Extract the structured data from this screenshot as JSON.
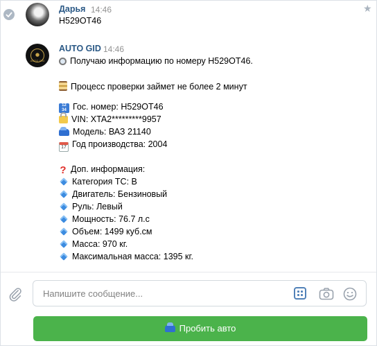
{
  "messages": [
    {
      "sender": "Дарья",
      "time": "14:46",
      "text": "Н529ОТ46"
    },
    {
      "sender": "AUTO GID",
      "time": "14:46",
      "avatar_text": "AUTO GID",
      "lines": [
        {
          "icon": "magnifier-icon",
          "text": "Получаю информацию по номеру Н529ОТ46."
        },
        {
          "icon": "hourglass-icon",
          "text": "Процесс проверки займет не более 2 минут"
        },
        {
          "icon": "numbers-1234-icon",
          "text": "Гос. номер: Н529ОТ46"
        },
        {
          "icon": "lock-icon",
          "text": "VIN: XTA2*********9957"
        },
        {
          "icon": "car-icon",
          "text": "Модель: ВАЗ 21140"
        },
        {
          "icon": "calendar-icon",
          "text": "Год производства: 2004"
        },
        {
          "icon": "question-icon",
          "text": "Доп. информация:"
        },
        {
          "icon": "diamond-icon",
          "text": "Категория ТС: B"
        },
        {
          "icon": "diamond-icon",
          "text": "Двигатель: Бензиновый"
        },
        {
          "icon": "diamond-icon",
          "text": "Руль: Левый"
        },
        {
          "icon": "diamond-icon",
          "text": "Мощность: 76.7 л.с"
        },
        {
          "icon": "diamond-icon",
          "text": "Объем: 1499 куб.см"
        },
        {
          "icon": "diamond-icon",
          "text": "Масса: 970 кг."
        },
        {
          "icon": "diamond-icon",
          "text": "Максимальная масса: 1395 кг."
        }
      ]
    }
  ],
  "composer": {
    "placeholder": "Напишите сообщение..."
  },
  "keyboard_button": {
    "label": "Пробить авто",
    "icon": "car-icon",
    "color": "#4bb34b"
  },
  "colors": {
    "sender_name": "#2a5885",
    "accent": "#5181b8"
  }
}
